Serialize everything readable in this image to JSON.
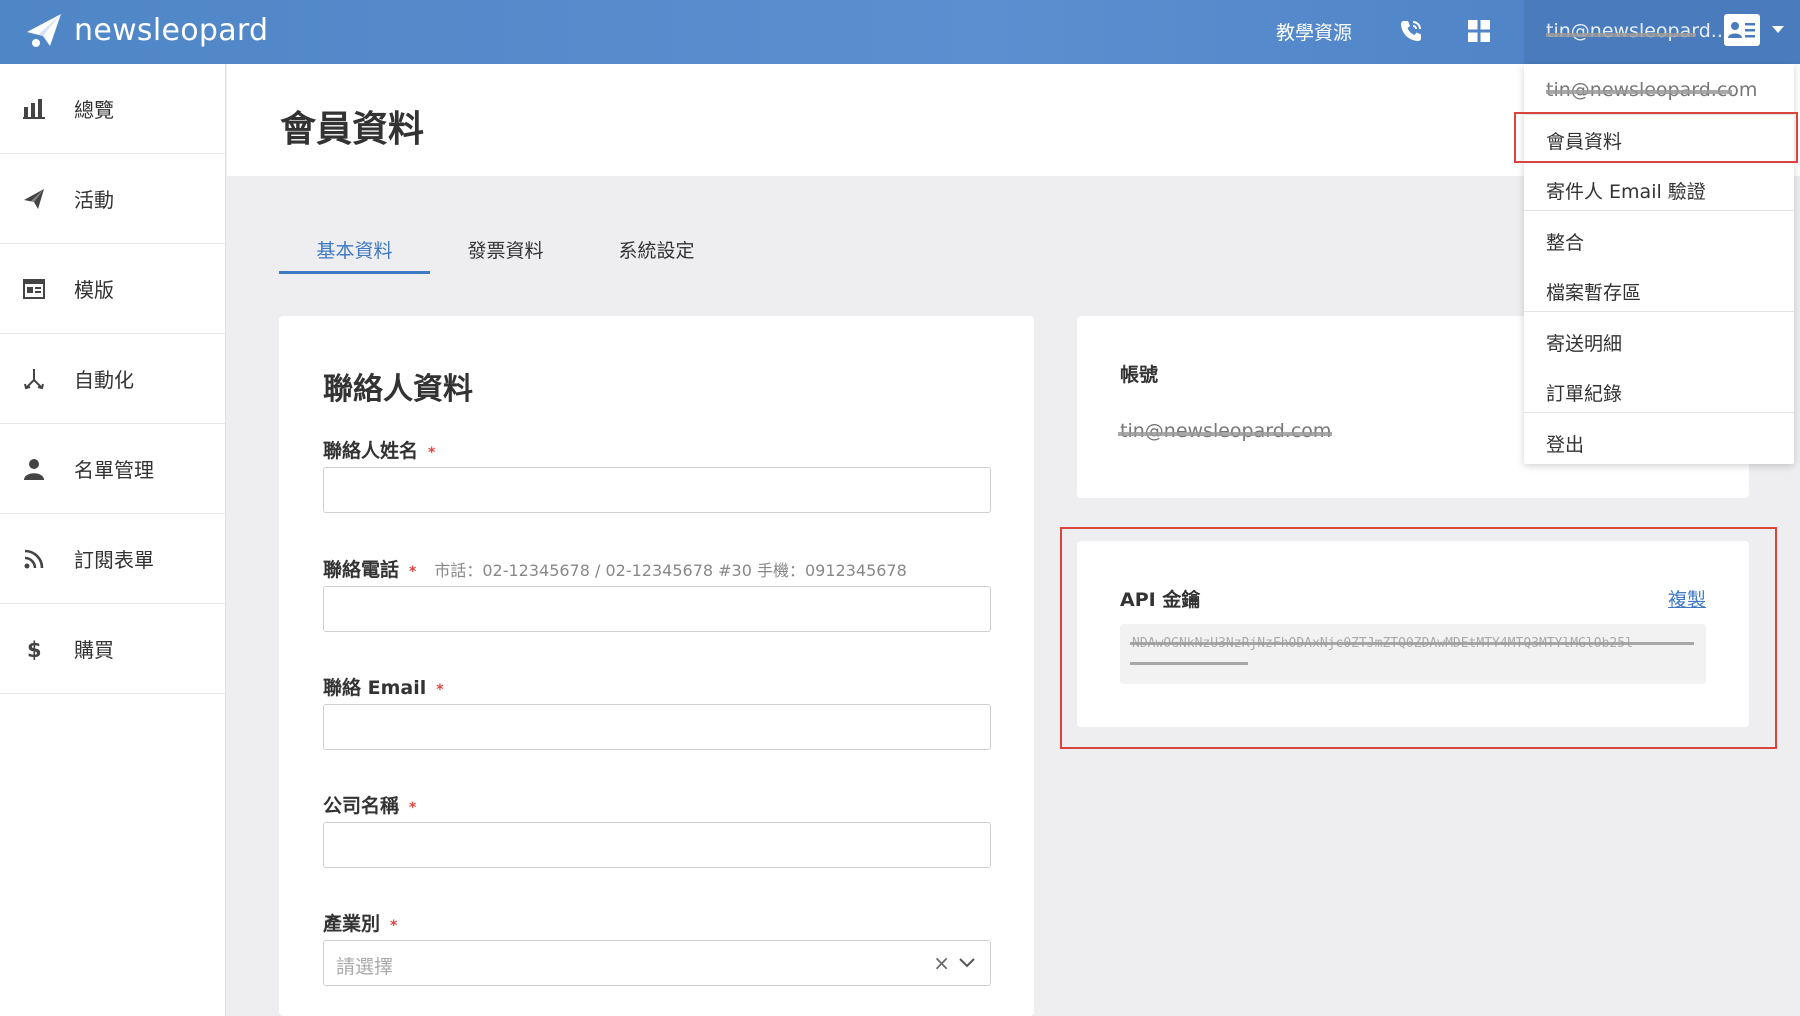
{
  "app": {
    "brand": "newsleopard",
    "colors": {
      "accent": "#3f79c2",
      "topbar": "#5a8fd0",
      "required": "#e0453e",
      "highlight": "#d9443d"
    }
  },
  "topbar": {
    "resources_label": "教學資源",
    "phone_icon": "phone-icon",
    "apps_icon": "grid-icon",
    "user_email": "tin@newsleopard...",
    "user_icon": "contact-card-icon"
  },
  "sidebar": {
    "items": [
      {
        "label": "總覽",
        "icon": "bar-chart-icon"
      },
      {
        "label": "活動",
        "icon": "paper-plane-icon"
      },
      {
        "label": "模版",
        "icon": "template-icon"
      },
      {
        "label": "自動化",
        "icon": "flow-icon"
      },
      {
        "label": "名單管理",
        "icon": "user-icon"
      },
      {
        "label": "訂閱表單",
        "icon": "rss-icon"
      },
      {
        "label": "購買",
        "icon": "dollar-icon"
      }
    ]
  },
  "page": {
    "title": "會員資料"
  },
  "tabs": [
    {
      "label": "基本資料",
      "active": true
    },
    {
      "label": "發票資料",
      "active": false
    },
    {
      "label": "系統設定",
      "active": false
    }
  ],
  "contact": {
    "title": "聯絡人資料",
    "required_mark": "*",
    "fields": {
      "name": {
        "label": "聯絡人姓名",
        "value": ""
      },
      "phone": {
        "label": "聯絡電話",
        "hint": "市話：02-12345678 / 02-12345678 #30 手機：0912345678",
        "value": ""
      },
      "email": {
        "label": "聯絡 Email",
        "value": ""
      },
      "company": {
        "label": "公司名稱",
        "value": ""
      },
      "industry": {
        "label": "產業別",
        "placeholder": "請選擇",
        "clear": "×"
      }
    }
  },
  "account": {
    "label": "帳號",
    "email": "tin@newsleopard.com"
  },
  "api": {
    "label": "API 金鑰",
    "copy_label": "複製",
    "key": "NDAwOGNkNzU3NzRjNzFhODAxNjc0ZTJmZTQ0ZDAwMDEtMTY4MTQ3MTYlMGlOb25l"
  },
  "dropdown": {
    "email": "tin@newsleopard.com",
    "items": [
      "會員資料",
      "寄件人 Email 驗證",
      "整合",
      "檔案暫存區",
      "寄送明細",
      "訂單紀錄",
      "登出"
    ]
  }
}
